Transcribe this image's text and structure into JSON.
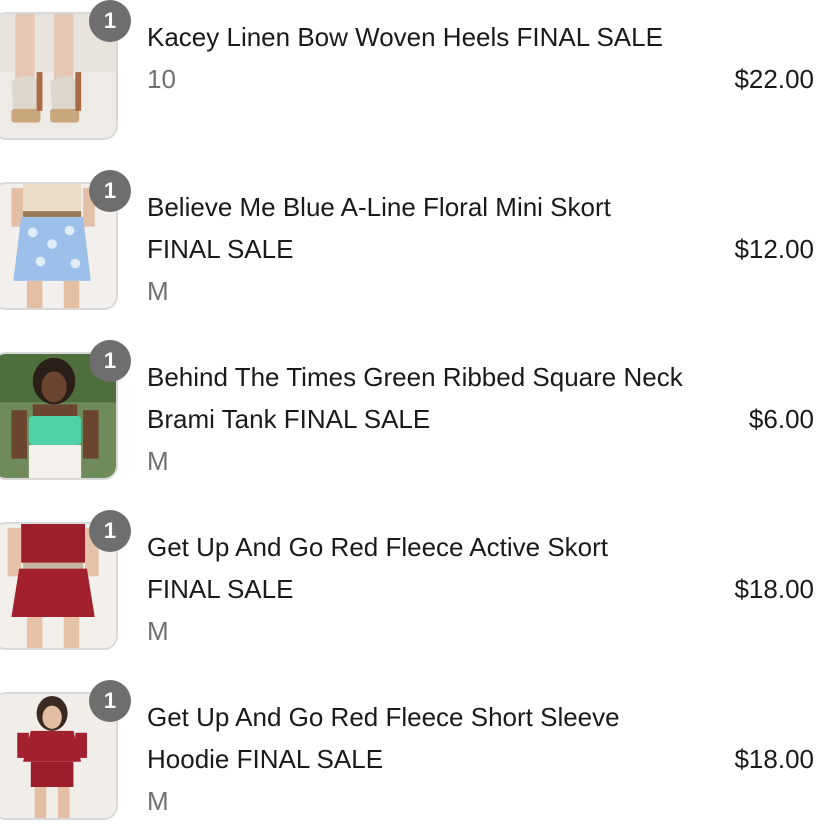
{
  "items": [
    {
      "quantity": "1",
      "title": "Kacey Linen Bow Woven Heels FINAL SALE",
      "variant": "10",
      "price": "$22.00",
      "image_icon": "heels-product-image"
    },
    {
      "quantity": "1",
      "title": "Believe Me Blue A-Line Floral Mini Skort FINAL SALE",
      "variant": "M",
      "price": "$12.00",
      "image_icon": "skort-product-image"
    },
    {
      "quantity": "1",
      "title": "Behind The Times Green Ribbed Square Neck Brami Tank FINAL SALE",
      "variant": "M",
      "price": "$6.00",
      "image_icon": "tank-product-image"
    },
    {
      "quantity": "1",
      "title": "Get Up And Go Red Fleece Active Skort FINAL SALE",
      "variant": "M",
      "price": "$18.00",
      "image_icon": "red-skort-product-image"
    },
    {
      "quantity": "1",
      "title": "Get Up And Go Red Fleece Short Sleeve Hoodie FINAL SALE",
      "variant": "M",
      "price": "$18.00",
      "image_icon": "red-hoodie-product-image"
    }
  ],
  "colors": {
    "badge": "#6e6e6e",
    "variant_text": "#707070",
    "thumb_border": "#d9d9d9"
  }
}
